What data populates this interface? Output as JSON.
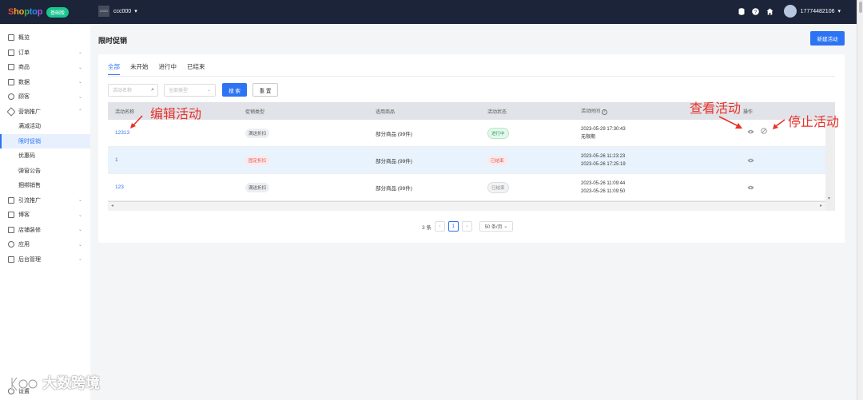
{
  "topbar": {
    "logo": {
      "p1": "S",
      "p2": "ho",
      "p3": "p",
      "p4": "to",
      "p5": "p"
    },
    "badge": "基础版",
    "store_thumb": "LOGO",
    "store_name": "ccc000",
    "user": "17774482106"
  },
  "sidebar": {
    "items": [
      {
        "label": "概览"
      },
      {
        "label": "订单"
      },
      {
        "label": "商品"
      },
      {
        "label": "数据"
      },
      {
        "label": "顾客"
      },
      {
        "label": "营销推广"
      },
      {
        "label": "满减活动"
      },
      {
        "label": "限时促销"
      },
      {
        "label": "优惠码"
      },
      {
        "label": "弹窗公告"
      },
      {
        "label": "捆绑销售"
      },
      {
        "label": "引流推广"
      },
      {
        "label": "博客"
      },
      {
        "label": "店铺装修"
      },
      {
        "label": "应用"
      },
      {
        "label": "后台管理"
      }
    ],
    "settings": "设置"
  },
  "page": {
    "title": "限时促销",
    "new_button": "新建活动",
    "tabs": [
      "全部",
      "未开始",
      "进行中",
      "已结束"
    ],
    "search_placeholder": "活动名称",
    "type_placeholder": "全部类型",
    "search_button": "搜 索",
    "reset_button": "重 置"
  },
  "table": {
    "headers": [
      "活动名称",
      "促销类型",
      "适用商品",
      "活动状态",
      "活动时间",
      "操作"
    ],
    "rows": [
      {
        "name": "12313",
        "type": "满送折扣",
        "goods": "部分商品 (99件)",
        "status": "进行中",
        "time1": "2023-05-29 17:30:43",
        "time2": "无限期"
      },
      {
        "name": "1",
        "type": "固定折扣",
        "goods": "部分商品 (99件)",
        "status": "已结束",
        "time1": "2023-05-26 11:23:23",
        "time2": "2023-05-26 17:25:19"
      },
      {
        "name": "123",
        "type": "满送折扣",
        "goods": "部分商品 (99件)",
        "status": "已结束",
        "time1": "2023-05-26 11:09:44",
        "time2": "2023-05-26 11:09:50"
      }
    ]
  },
  "pagination": {
    "total": "3 条",
    "current": "1",
    "page_size": "50 条/页"
  },
  "annotations": {
    "edit": "编辑活动",
    "view": "查看活动",
    "stop": "停止活动"
  },
  "watermark": "大数跨境",
  "colors": {
    "primary": "#2d74f4",
    "topbar": "#1b2438",
    "annotation": "#e8322b"
  }
}
